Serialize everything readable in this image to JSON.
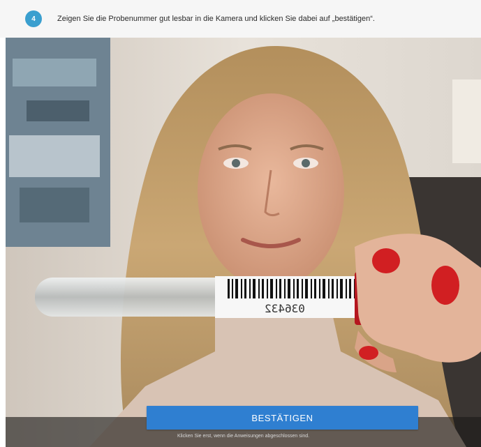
{
  "instruction": {
    "step_number": "4",
    "text": "Zeigen Sie die Probenummer gut lesbar in die Kamera und klicken Sie dabei auf „bestätigen“."
  },
  "camera": {
    "sample_number": "036432"
  },
  "actions": {
    "confirm_label": "BESTÄTIGEN",
    "hint": "Klicken Sie erst, wenn die Anweisungen abgeschlossen sind."
  },
  "colors": {
    "accent_blue": "#2f7fd1",
    "step_badge": "#3a9fcf",
    "cap_red": "#d6202a",
    "nail_red": "#d11f22"
  }
}
